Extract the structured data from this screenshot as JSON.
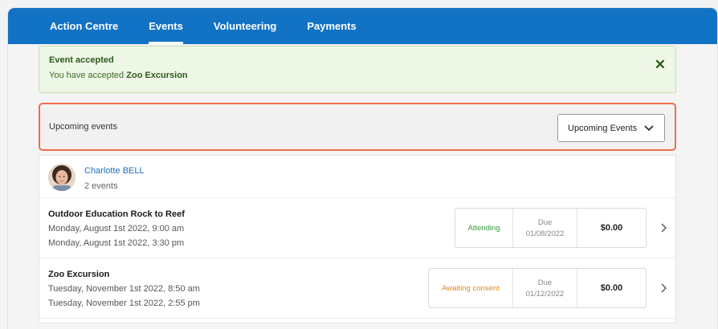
{
  "nav": {
    "items": [
      {
        "label": "Action Centre"
      },
      {
        "label": "Events"
      },
      {
        "label": "Volunteering"
      },
      {
        "label": "Payments"
      }
    ],
    "active": "Events"
  },
  "alert": {
    "title": "Event accepted",
    "message_prefix": "You have accepted",
    "message_event": "Zoo Excursion",
    "close_icon": "close-icon"
  },
  "filter": {
    "label": "Upcoming events",
    "selected": "Upcoming Events"
  },
  "person": {
    "name": "Charlotte BELL",
    "event_count": "2 events"
  },
  "events": [
    {
      "title": "Outdoor Education Rock to Reef",
      "start": "Monday, August 1st 2022, 9:00 am",
      "end": "Monday, August 1st 2022, 3:30 pm",
      "status": "Attending",
      "status_color": "#3a9a3a",
      "due_label": "Due",
      "due_date": "01/08/2022",
      "amount": "$0.00"
    },
    {
      "title": "Zoo Excursion",
      "start": "Tuesday, November 1st 2022, 8:50 am",
      "end": "Tuesday, November 1st 2022, 2:55 pm",
      "status": "Awaiting consent",
      "status_color": "#e08a1e",
      "due_label": "Due",
      "due_date": "01/12/2022",
      "amount": "$0.00"
    }
  ],
  "colors": {
    "nav_bg": "#1272c4",
    "accent_highlight": "#ef6d4c",
    "link": "#1b6fc2",
    "success_bg": "#eef6e6"
  }
}
